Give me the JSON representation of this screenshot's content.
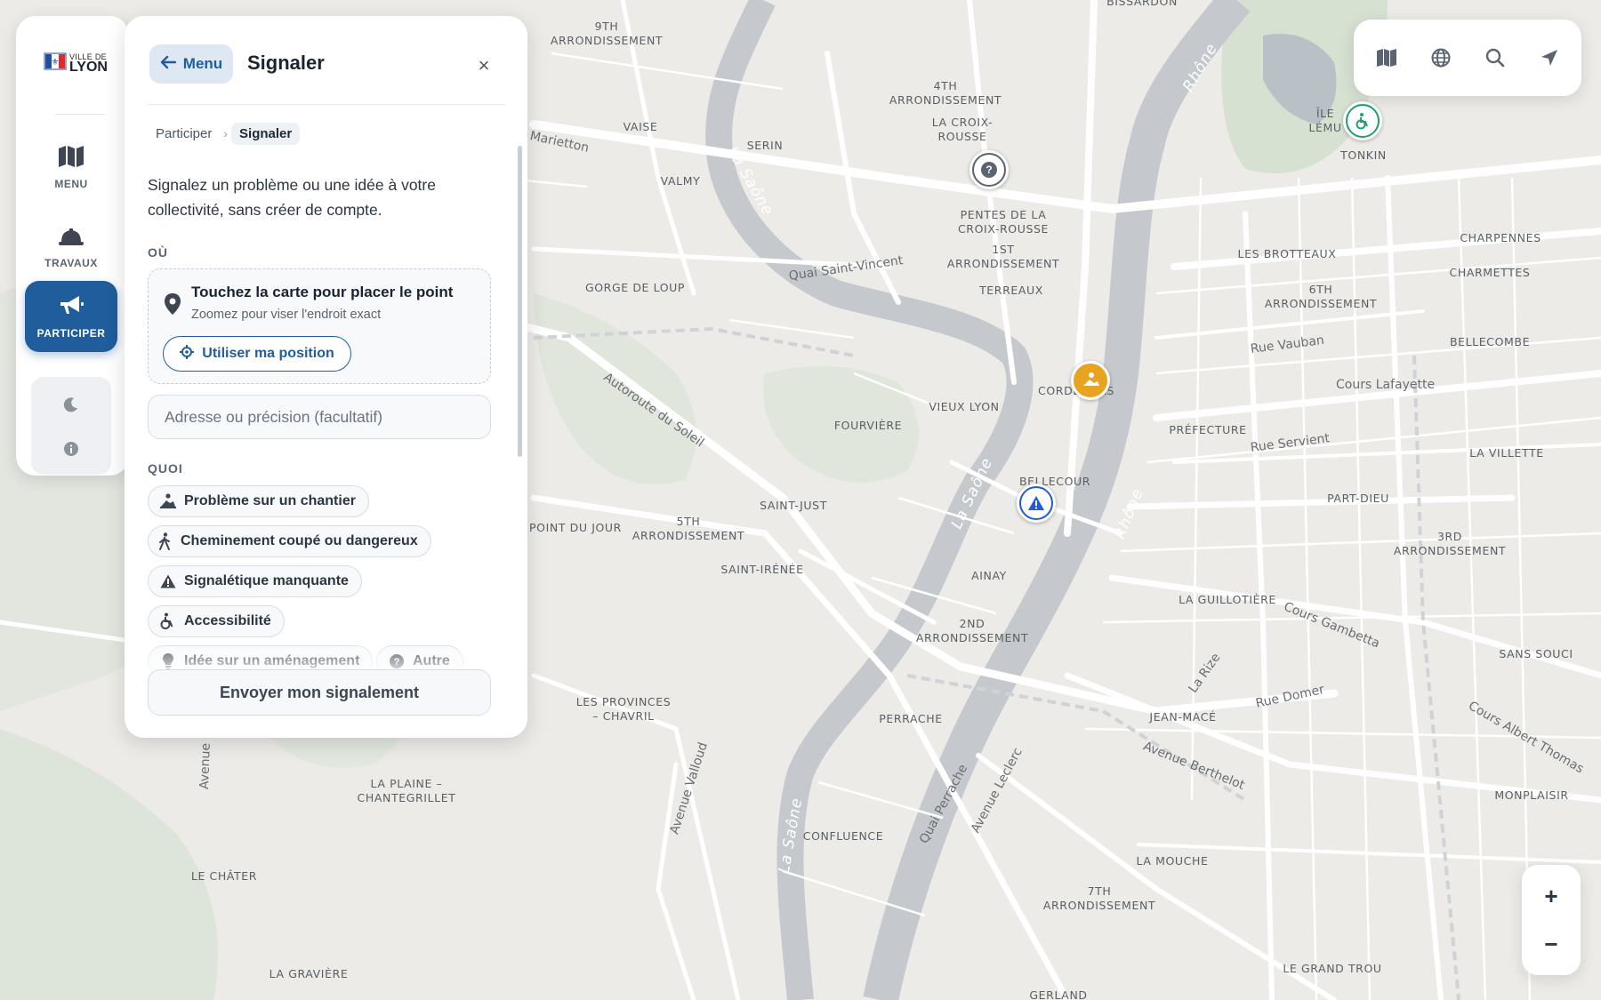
{
  "brand": {
    "line1": "VILLE DE",
    "line2": "LYON"
  },
  "rail": {
    "items": [
      {
        "label": "MENU",
        "icon": "map-icon"
      },
      {
        "label": "TRAVAUX",
        "icon": "hard-hat-icon"
      },
      {
        "label": "PARTICIPER",
        "icon": "megaphone-icon",
        "active": true
      }
    ],
    "tools": [
      "moon-icon",
      "info-icon"
    ]
  },
  "panel": {
    "back_label": "Menu",
    "title": "Signaler",
    "close_label": "×",
    "breadcrumb": [
      "Participer",
      "Signaler"
    ],
    "intro": "Signalez un problème ou une idée à votre collectivité, sans créer de compte.",
    "where_label": "OÙ",
    "where_title": "Touchez la carte pour placer le point",
    "where_sub": "Zoomez pour viser l'endroit exact",
    "position_button": "Utiliser ma position",
    "address_placeholder": "Adresse ou précision (facultatif)",
    "what_label": "QUOI",
    "categories": [
      {
        "label": "Problème sur un chantier",
        "icon": "worker-icon"
      },
      {
        "label": "Cheminement coupé ou dangereux",
        "icon": "pedestrian-icon"
      },
      {
        "label": "Signalétique manquante",
        "icon": "warning-icon"
      },
      {
        "label": "Accessibilité",
        "icon": "wheelchair-icon"
      },
      {
        "label": "Idée sur un aménagement",
        "icon": "lightbulb-icon"
      },
      {
        "label": "Autre",
        "icon": "question-icon"
      }
    ],
    "submit_label": "Envoyer mon signalement"
  },
  "map": {
    "districts": [
      "9TH\nARRONDISSEMENT",
      "4TH\nARRONDISSEMENT",
      "LA CROIX-\nROUSSE",
      "VAISE",
      "SERIN",
      "VALMY",
      "PENTES DE LA\nCROIX-ROUSSE",
      "1ST\nARRONDISSEMENT",
      "TERREAUX",
      "GORGE DE LOUP",
      "CORDELIERS",
      "VIEUX LYON",
      "FOURVIÈRE",
      "BELLECOUR",
      "SAINT-JUST",
      "5TH\nARRONDISSEMENT",
      "POINT DU JOUR",
      "SAINT-IRÉNÉE",
      "AINAY",
      "2ND\nARRONDISSEMENT",
      "LES PROVINCES\n– CHAVRIL",
      "PERRACHE",
      "LA PLAINE –\nCHANTEGRILLET",
      "CONFLUENCE",
      "LE CHÂTER",
      "LA GRAVIÈRE",
      "TONKIN",
      "ÎLE\nLÉMU",
      "LES BROTTEAUX",
      "CHARPENNES",
      "CHARMETTES",
      "6TH\nARRONDISSEMENT",
      "BELLECOMBE",
      "PRÉFECTURE",
      "LA VILLETTE",
      "PART-DIEU",
      "3RD\nARRONDISSEMENT",
      "LA GUILLOTIÈRE",
      "SANS SOUCI",
      "JEAN-MACÉ",
      "MONPLAISIR",
      "LA MOUCHE",
      "7TH\nARRONDISSEMENT",
      "LE GRAND TROU",
      "BISSARDON",
      "GERLAND"
    ],
    "streets": [
      "Marietton",
      "Quai Saint-Vincent",
      "Autoroute du Soleil",
      "Rue Vauban",
      "Cours Lafayette",
      "Rue Servient",
      "Cours Gambetta",
      "Rue Domer",
      "Avenue Berthelot",
      "Cours Albert Thomas",
      "Avenue Valloud",
      "Avenue",
      "Quai Perrache",
      "Avenue Leclerc",
      "La Rize"
    ],
    "rivers": [
      "La Saône",
      "Rhône",
      "La Saône",
      "Rhône",
      "La Saône"
    ],
    "markers": [
      {
        "type": "question",
        "color": "#5b6470"
      },
      {
        "type": "worker",
        "color": "#e8a321"
      },
      {
        "type": "warning",
        "color": "#1f5dd6"
      },
      {
        "type": "wheelchair",
        "color": "#20a070"
      }
    ],
    "colors": {
      "land": "#ecebe7",
      "water": "#c5c9cd",
      "park": "#dfe5dc",
      "road": "#ffffff"
    }
  },
  "toolbar": {
    "icons": [
      "map-icon",
      "globe-icon",
      "search-icon",
      "locate-icon"
    ]
  },
  "zoom": {
    "in": "+",
    "out": "−"
  }
}
